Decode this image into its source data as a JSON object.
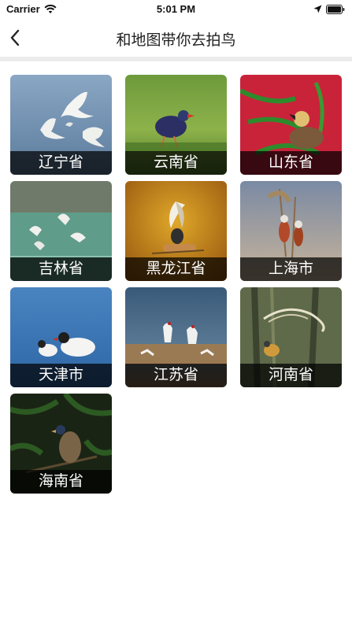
{
  "status_bar": {
    "carrier": "Carrier",
    "time": "5:01 PM"
  },
  "nav": {
    "title": "和地图带你去拍鸟",
    "back_icon": "chevron-left-icon"
  },
  "provinces": [
    {
      "name": "辽宁省",
      "scene": "white birds in flight over blue-grey water"
    },
    {
      "name": "云南省",
      "scene": "purple swamphen on green grass"
    },
    {
      "name": "山东省",
      "scene": "bird on a nest among green leaves, red background"
    },
    {
      "name": "吉林省",
      "scene": "terns over green water"
    },
    {
      "name": "黑龙江省",
      "scene": "dancing bird on a reed head, golden background"
    },
    {
      "name": "上海市",
      "scene": "birds perched on reeds"
    },
    {
      "name": "天津市",
      "scene": "black-headed gulls on water"
    },
    {
      "name": "江苏省",
      "scene": "cranes among reeds"
    },
    {
      "name": "河南省",
      "scene": "long-tailed bird in a forest"
    },
    {
      "name": "海南省",
      "scene": "pheasant in dark foliage"
    }
  ]
}
